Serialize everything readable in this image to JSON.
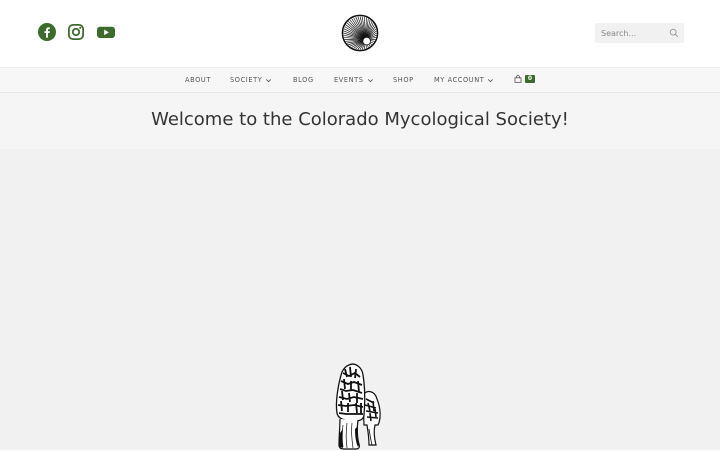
{
  "header": {
    "social": [
      {
        "icon": "facebook-icon",
        "color": "#3c6b2b"
      },
      {
        "icon": "instagram-icon",
        "color": "#3c6b2b"
      },
      {
        "icon": "youtube-icon",
        "color": "#3c6b2b"
      }
    ],
    "logo_icon": "mushroom-gills-logo",
    "search": {
      "placeholder": "Search..."
    }
  },
  "nav": {
    "items": [
      {
        "label": "ABOUT",
        "has_dropdown": false
      },
      {
        "label": "SOCIETY",
        "has_dropdown": true
      },
      {
        "label": "BLOG",
        "has_dropdown": false
      },
      {
        "label": "EVENTS",
        "has_dropdown": true
      },
      {
        "label": "SHOP",
        "has_dropdown": false
      },
      {
        "label": "MY ACCOUNT",
        "has_dropdown": true
      }
    ],
    "cart": {
      "icon": "shopping-bag-icon",
      "count": "0"
    }
  },
  "page": {
    "title": "Welcome to the Colorado Mycological Society!"
  },
  "hero": {
    "image_icon": "morel-mushroom-illustration"
  },
  "colors": {
    "accent": "#3c6b2b",
    "nav_bg": "#f7f7f7",
    "hero_bg": "#f1f1f1"
  }
}
